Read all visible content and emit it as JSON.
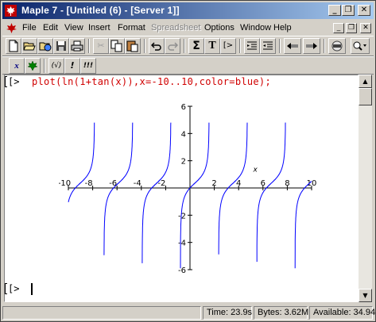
{
  "window": {
    "title": "Maple 7 - [Untitled (6) - [Server 1]]"
  },
  "title_buttons": {
    "minimize": "_",
    "restore": "❐",
    "close": "✕"
  },
  "menu": [
    {
      "label": "File",
      "disabled": false
    },
    {
      "label": "Edit",
      "disabled": false
    },
    {
      "label": "View",
      "disabled": false
    },
    {
      "label": "Insert",
      "disabled": false
    },
    {
      "label": "Format",
      "disabled": false
    },
    {
      "label": "Spreadsheet",
      "disabled": true
    },
    {
      "label": "Options",
      "disabled": false
    },
    {
      "label": "Window",
      "disabled": false
    },
    {
      "label": "Help",
      "disabled": false
    }
  ],
  "toolbar": {
    "new_icon": "new-document-icon",
    "open_icon": "open-folder-icon",
    "open_url_icon": "open-url-icon",
    "save_icon": "save-icon",
    "print_icon": "print-icon",
    "cut_icon": "cut-icon",
    "copy_icon": "copy-icon",
    "paste_icon": "paste-icon",
    "undo_icon": "undo-icon",
    "redo_icon": "redo-icon",
    "sigma_label": "Σ",
    "text_label": "T",
    "prompt_label": "[>"
  },
  "context_bar": {
    "math_label": "x",
    "maple_label": "✲",
    "eval_label": "(√)",
    "bang_label": "!",
    "bangbang_label": "!!!"
  },
  "document": {
    "prompt1": "[>",
    "command": "plot(ln(1+tan(x)),x=-10..10,color=blue);",
    "prompt2": "[>"
  },
  "chart_data": {
    "type": "line",
    "function": "ln(1+tan(x))",
    "xlim": [
      -10,
      10
    ],
    "ylim": [
      -6,
      6
    ],
    "xticks": [
      "-10",
      "-8",
      "-6",
      "-4",
      "-2",
      "2",
      "4",
      "6",
      "8",
      "10"
    ],
    "yticks": [
      "6",
      "4",
      "2",
      "-2",
      "-4",
      "-6"
    ],
    "xlabel": "x",
    "color": "#0000ff"
  },
  "status": {
    "time": "Time: 23.9s",
    "bytes": "Bytes: 3.62M",
    "available": "Available: 34.94"
  }
}
